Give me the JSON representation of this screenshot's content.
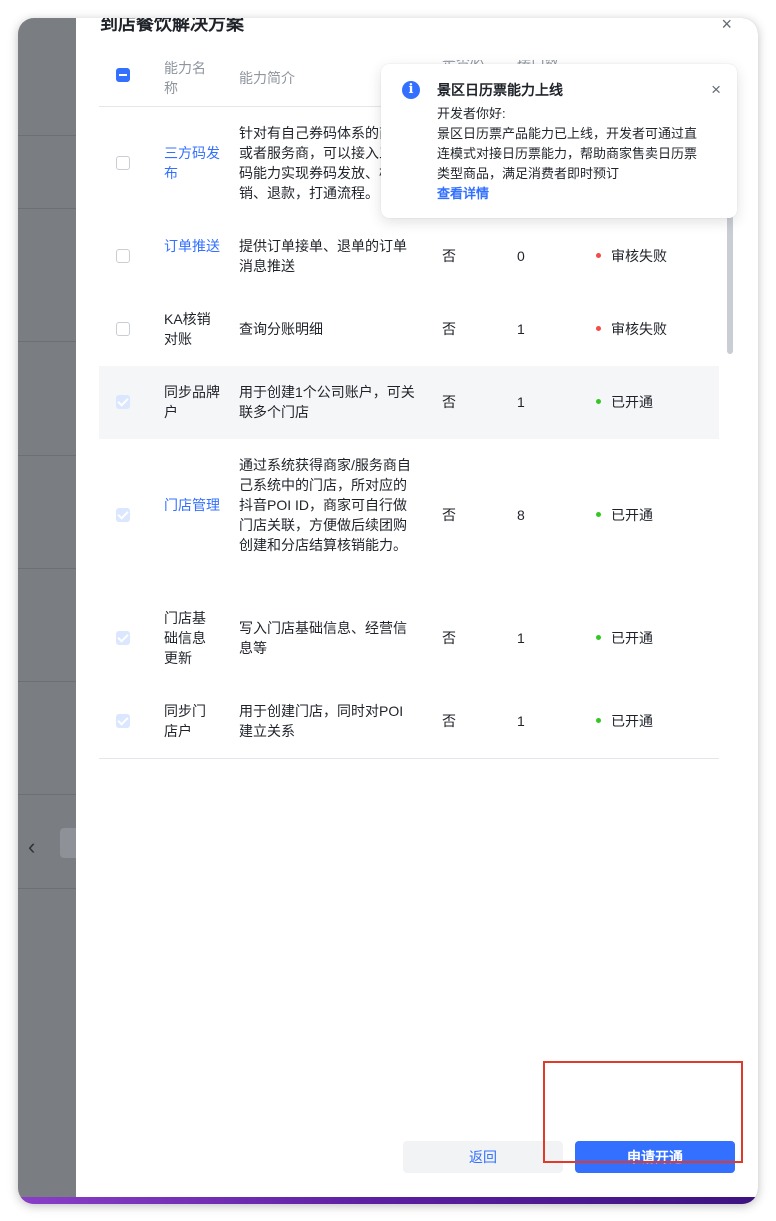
{
  "modal": {
    "title": "到店餐饮解决方案",
    "close_icon": "×"
  },
  "table": {
    "headers": {
      "name": "能力名称",
      "desc": "能力简介",
      "must": "是否必",
      "count": "接口数"
    },
    "rows": [
      {
        "name": "三方码发布",
        "name_is_link": true,
        "desc": "针对有自己券码体系的商家或者服务商，可以接入三方码能力实现券码发放、核销、退款，打通流程。",
        "must": "",
        "count": "",
        "status": "",
        "status_color": "",
        "checkbox": "unchecked"
      },
      {
        "name": "订单推送",
        "name_is_link": true,
        "desc": "提供订单接单、退单的订单消息推送",
        "must": "否",
        "count": "0",
        "status": "审核失败",
        "status_color": "#f54a45",
        "checkbox": "unchecked"
      },
      {
        "name": "KA核销对账",
        "name_is_link": false,
        "desc": "查询分账明细",
        "must": "否",
        "count": "1",
        "status": "审核失败",
        "status_color": "#f54a45",
        "checkbox": "unchecked"
      },
      {
        "name": "同步品牌户",
        "name_is_link": false,
        "desc": "用于创建1个公司账户，可关联多个门店",
        "must": "否",
        "count": "1",
        "status": "已开通",
        "status_color": "#34c724",
        "checkbox": "checked-disabled"
      },
      {
        "name": "门店管理",
        "name_is_link": true,
        "desc": "通过系统获得商家/服务商自己系统中的门店，所对应的抖音POI ID，商家可自行做门店关联，方便做后续团购创建和分店结算核销能力。",
        "must": "否",
        "count": "8",
        "status": "已开通",
        "status_color": "#34c724",
        "checkbox": "checked-disabled"
      },
      {
        "name": "门店基础信息更新",
        "name_is_link": false,
        "desc": "写入门店基础信息、经营信息等",
        "must": "否",
        "count": "1",
        "status": "已开通",
        "status_color": "#34c724",
        "checkbox": "checked-disabled"
      },
      {
        "name": "同步门店户",
        "name_is_link": false,
        "desc": "用于创建门店，同时对POI建立关系",
        "must": "否",
        "count": "1",
        "status": "已开通",
        "status_color": "#34c724",
        "checkbox": "checked-disabled"
      }
    ]
  },
  "notice": {
    "title": "景区日历票能力上线",
    "greeting": "开发者你好:",
    "body": "景区日历票产品能力已上线，开发者可通过直连模式对接日历票能力，帮助商家售卖日历票类型商品，满足消费者即时预订",
    "link": "查看详情",
    "close_icon": "×",
    "info_icon": "i"
  },
  "footer": {
    "back_label": "返回",
    "apply_label": "申请开通"
  },
  "background": {
    "chevron": "‹"
  },
  "colors": {
    "primary": "#3370ff",
    "fail": "#f54a45",
    "success": "#34c724",
    "highlight": "#e03a2b"
  }
}
